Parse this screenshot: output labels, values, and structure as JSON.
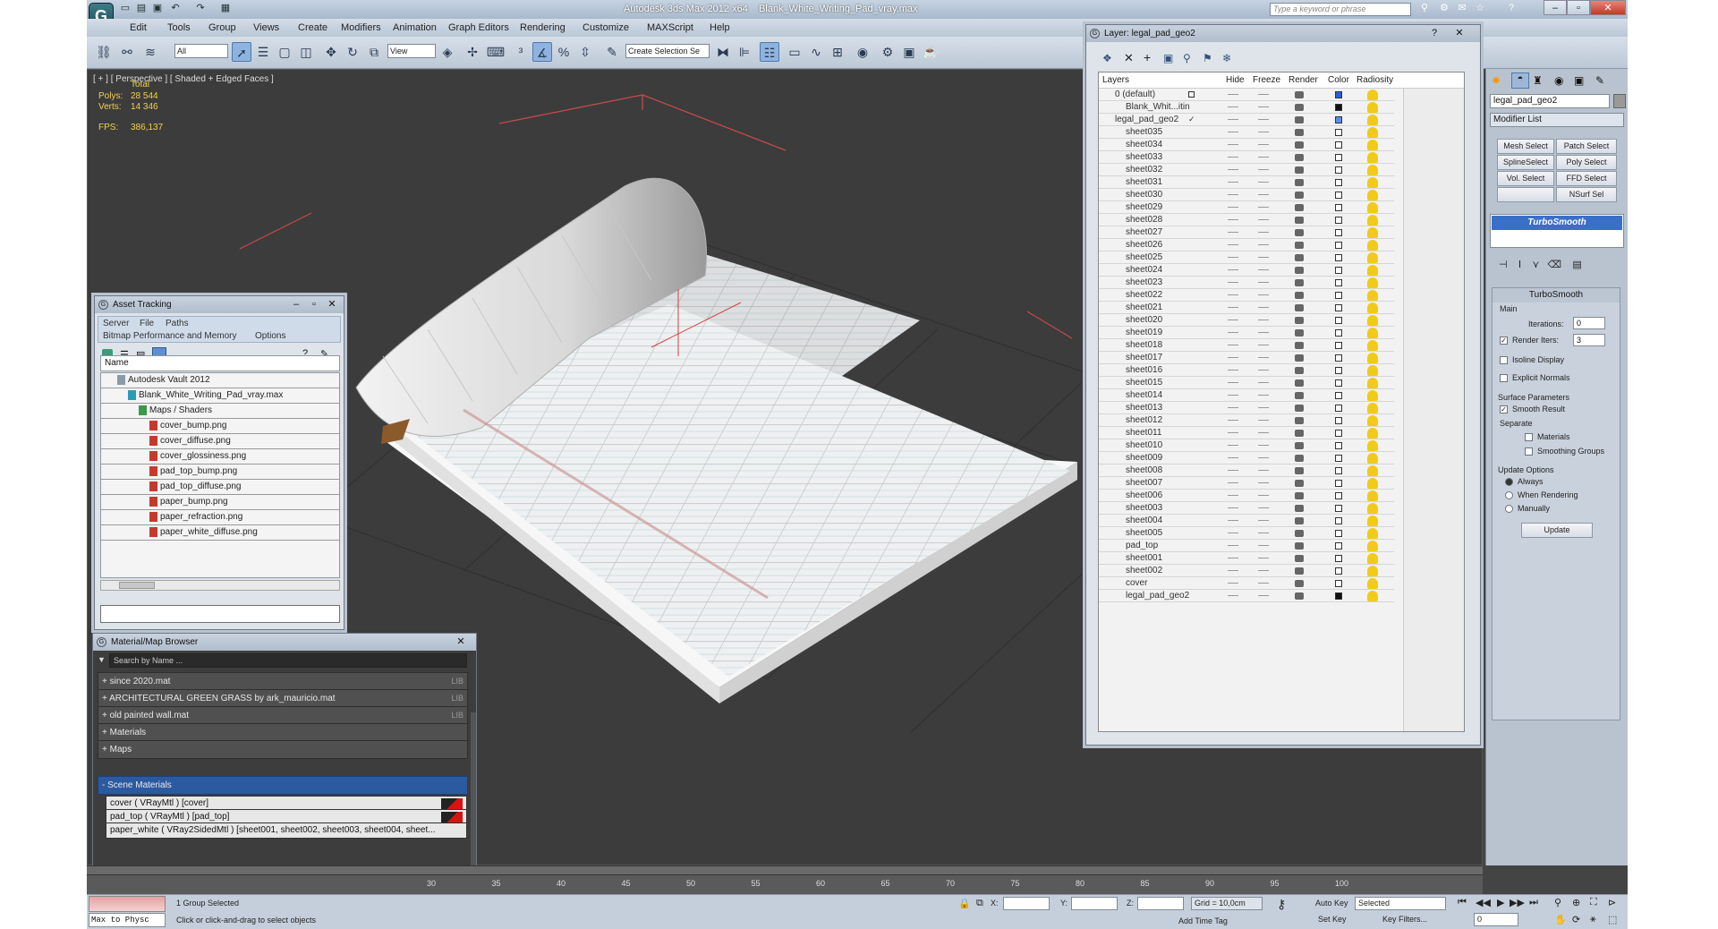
{
  "window": {
    "app_title": "Autodesk 3ds Max  2012 x64",
    "file_title": "Blank_White_Writing_Pad_vray.max",
    "search_placeholder": "Type a keyword or phrase"
  },
  "menu": [
    "Edit",
    "Tools",
    "Group",
    "Views",
    "Create",
    "Modifiers",
    "Animation",
    "Graph Editors",
    "Rendering",
    "Customize",
    "MAXScript",
    "Help"
  ],
  "toolbar": {
    "filter_value": "All",
    "ref_coord_value": "View",
    "selection_set_placeholder": "Create Selection Se"
  },
  "viewport": {
    "label": "[ + ] [ Perspective ] [ Shaded + Edged Faces ]",
    "stats_header": "Total",
    "polys_label": "Polys:",
    "polys_value": "28 544",
    "verts_label": "Verts:",
    "verts_value": "14 346",
    "fps_label": "FPS:",
    "fps_value": "386,137"
  },
  "asset_tracking": {
    "title": "Asset Tracking",
    "menu_row1": [
      "Server",
      "File",
      "Paths"
    ],
    "menu_row2": [
      "Bitmap Performance and Memory",
      "Options"
    ],
    "column_header": "Name",
    "tree": [
      {
        "label": "Autodesk Vault 2012",
        "indent": 18,
        "icon": "vault-icon"
      },
      {
        "label": "Blank_White_Writing_Pad_vray.max",
        "indent": 30,
        "icon": "max-file-icon"
      },
      {
        "label": "Maps / Shaders",
        "indent": 42,
        "icon": "folder-icon"
      },
      {
        "label": "cover_bump.png",
        "indent": 54,
        "icon": "image-file-icon"
      },
      {
        "label": "cover_diffuse.png",
        "indent": 54,
        "icon": "image-file-icon"
      },
      {
        "label": "cover_glossiness.png",
        "indent": 54,
        "icon": "image-file-icon"
      },
      {
        "label": "pad_top_bump.png",
        "indent": 54,
        "icon": "image-file-icon"
      },
      {
        "label": "pad_top_diffuse.png",
        "indent": 54,
        "icon": "image-file-icon"
      },
      {
        "label": "paper_bump.png",
        "indent": 54,
        "icon": "image-file-icon"
      },
      {
        "label": "paper_refraction.png",
        "indent": 54,
        "icon": "image-file-icon"
      },
      {
        "label": "paper_white_diffuse.png",
        "indent": 54,
        "icon": "image-file-icon"
      }
    ]
  },
  "material_browser": {
    "title": "Material/Map Browser",
    "search_placeholder": "Search by Name ...",
    "groups": [
      {
        "label": "+ since 2020.mat",
        "tag": "LIB"
      },
      {
        "label": "+ ARCHITECTURAL GREEN GRASS by ark_mauricio.mat",
        "tag": "LIB"
      },
      {
        "label": "+ old painted wall.mat",
        "tag": "LIB"
      },
      {
        "label": "+ Materials",
        "tag": ""
      },
      {
        "label": "+ Maps",
        "tag": ""
      }
    ],
    "scene_group": "- Scene Materials",
    "scene_items": [
      "cover  ( VRayMtl )  [cover]",
      "pad_top  ( VRayMtl )  [pad_top]",
      "paper_white  ( VRay2SidedMtl )  [sheet001, sheet002, sheet003, sheet004, sheet..."
    ]
  },
  "layer_dialog": {
    "title": "Layer: legal_pad_geo2",
    "columns": [
      "Layers",
      "Hide",
      "Freeze",
      "Render",
      "Color",
      "Radiosity"
    ],
    "rows": [
      {
        "name": "0 (default)",
        "level": 0,
        "color": "#2a5fcf",
        "check": "box"
      },
      {
        "name": "Blank_Whit...itin",
        "level": 1,
        "color": "#111111",
        "check": ""
      },
      {
        "name": "legal_pad_geo2",
        "level": 0,
        "color": "#5b8ee6",
        "check": "✓"
      },
      {
        "name": "sheet035",
        "level": 1,
        "color": "#ffffff",
        "check": ""
      },
      {
        "name": "sheet034",
        "level": 1,
        "color": "#ffffff",
        "check": ""
      },
      {
        "name": "sheet033",
        "level": 1,
        "color": "#ffffff",
        "check": ""
      },
      {
        "name": "sheet032",
        "level": 1,
        "color": "#ffffff",
        "check": ""
      },
      {
        "name": "sheet031",
        "level": 1,
        "color": "#ffffff",
        "check": ""
      },
      {
        "name": "sheet030",
        "level": 1,
        "color": "#ffffff",
        "check": ""
      },
      {
        "name": "sheet029",
        "level": 1,
        "color": "#ffffff",
        "check": ""
      },
      {
        "name": "sheet028",
        "level": 1,
        "color": "#ffffff",
        "check": ""
      },
      {
        "name": "sheet027",
        "level": 1,
        "color": "#ffffff",
        "check": ""
      },
      {
        "name": "sheet026",
        "level": 1,
        "color": "#ffffff",
        "check": ""
      },
      {
        "name": "sheet025",
        "level": 1,
        "color": "#ffffff",
        "check": ""
      },
      {
        "name": "sheet024",
        "level": 1,
        "color": "#ffffff",
        "check": ""
      },
      {
        "name": "sheet023",
        "level": 1,
        "color": "#ffffff",
        "check": ""
      },
      {
        "name": "sheet022",
        "level": 1,
        "color": "#ffffff",
        "check": ""
      },
      {
        "name": "sheet021",
        "level": 1,
        "color": "#ffffff",
        "check": ""
      },
      {
        "name": "sheet020",
        "level": 1,
        "color": "#ffffff",
        "check": ""
      },
      {
        "name": "sheet019",
        "level": 1,
        "color": "#ffffff",
        "check": ""
      },
      {
        "name": "sheet018",
        "level": 1,
        "color": "#ffffff",
        "check": ""
      },
      {
        "name": "sheet017",
        "level": 1,
        "color": "#ffffff",
        "check": ""
      },
      {
        "name": "sheet016",
        "level": 1,
        "color": "#ffffff",
        "check": ""
      },
      {
        "name": "sheet015",
        "level": 1,
        "color": "#ffffff",
        "check": ""
      },
      {
        "name": "sheet014",
        "level": 1,
        "color": "#ffffff",
        "check": ""
      },
      {
        "name": "sheet013",
        "level": 1,
        "color": "#ffffff",
        "check": ""
      },
      {
        "name": "sheet012",
        "level": 1,
        "color": "#ffffff",
        "check": ""
      },
      {
        "name": "sheet011",
        "level": 1,
        "color": "#ffffff",
        "check": ""
      },
      {
        "name": "sheet010",
        "level": 1,
        "color": "#ffffff",
        "check": ""
      },
      {
        "name": "sheet009",
        "level": 1,
        "color": "#ffffff",
        "check": ""
      },
      {
        "name": "sheet008",
        "level": 1,
        "color": "#ffffff",
        "check": ""
      },
      {
        "name": "sheet007",
        "level": 1,
        "color": "#ffffff",
        "check": ""
      },
      {
        "name": "sheet006",
        "level": 1,
        "color": "#ffffff",
        "check": ""
      },
      {
        "name": "sheet003",
        "level": 1,
        "color": "#ffffff",
        "check": ""
      },
      {
        "name": "sheet004",
        "level": 1,
        "color": "#ffffff",
        "check": ""
      },
      {
        "name": "sheet005",
        "level": 1,
        "color": "#ffffff",
        "check": ""
      },
      {
        "name": "pad_top",
        "level": 1,
        "color": "#ffffff",
        "check": ""
      },
      {
        "name": "sheet001",
        "level": 1,
        "color": "#ffffff",
        "check": ""
      },
      {
        "name": "sheet002",
        "level": 1,
        "color": "#ffffff",
        "check": ""
      },
      {
        "name": "cover",
        "level": 1,
        "color": "#ffffff",
        "check": ""
      },
      {
        "name": "legal_pad_geo2",
        "level": 1,
        "color": "#111111",
        "check": ""
      }
    ]
  },
  "command_panel": {
    "object_name": "legal_pad_geo2",
    "modifier_list": "Modifier List",
    "buttons": [
      "Mesh Select",
      "Patch Select",
      "SplineSelect",
      "Poly Select",
      "Vol. Select",
      "FFD Select",
      "",
      "NSurf Sel"
    ],
    "stack_item": "TurboSmooth",
    "rollout_title": "TurboSmooth",
    "main_label": "Main",
    "iterations_label": "Iterations:",
    "iterations_value": "0",
    "render_iters_label": "Render Iters:",
    "render_iters_value": "3",
    "isoline": "Isoline Display",
    "explicit": "Explicit Normals",
    "surface_params": "Surface Parameters",
    "smooth_result": "Smooth Result",
    "separate": "Separate",
    "materials": "Materials",
    "smoothing_groups": "Smoothing Groups",
    "update_options": "Update Options",
    "always": "Always",
    "when_rendering": "When Rendering",
    "manually": "Manually",
    "update_btn": "Update"
  },
  "timeline": {
    "ticks": [
      "30",
      "35",
      "40",
      "45",
      "50",
      "55",
      "60",
      "65",
      "70",
      "75",
      "80",
      "85",
      "90",
      "95",
      "100"
    ]
  },
  "status": {
    "maxscript": "Max to Physc",
    "selection": "1 Group Selected",
    "prompt": "Click or click-and-drag to select objects",
    "x_label": "X:",
    "y_label": "Y:",
    "z_label": "Z:",
    "grid": "Grid = 10,0cm",
    "auto_key": "Auto Key",
    "auto_key_value": "Selected",
    "set_key": "Set Key",
    "key_filters": "Key Filters...",
    "add_time_tag": "Add Time Tag",
    "frame_value": "0"
  }
}
